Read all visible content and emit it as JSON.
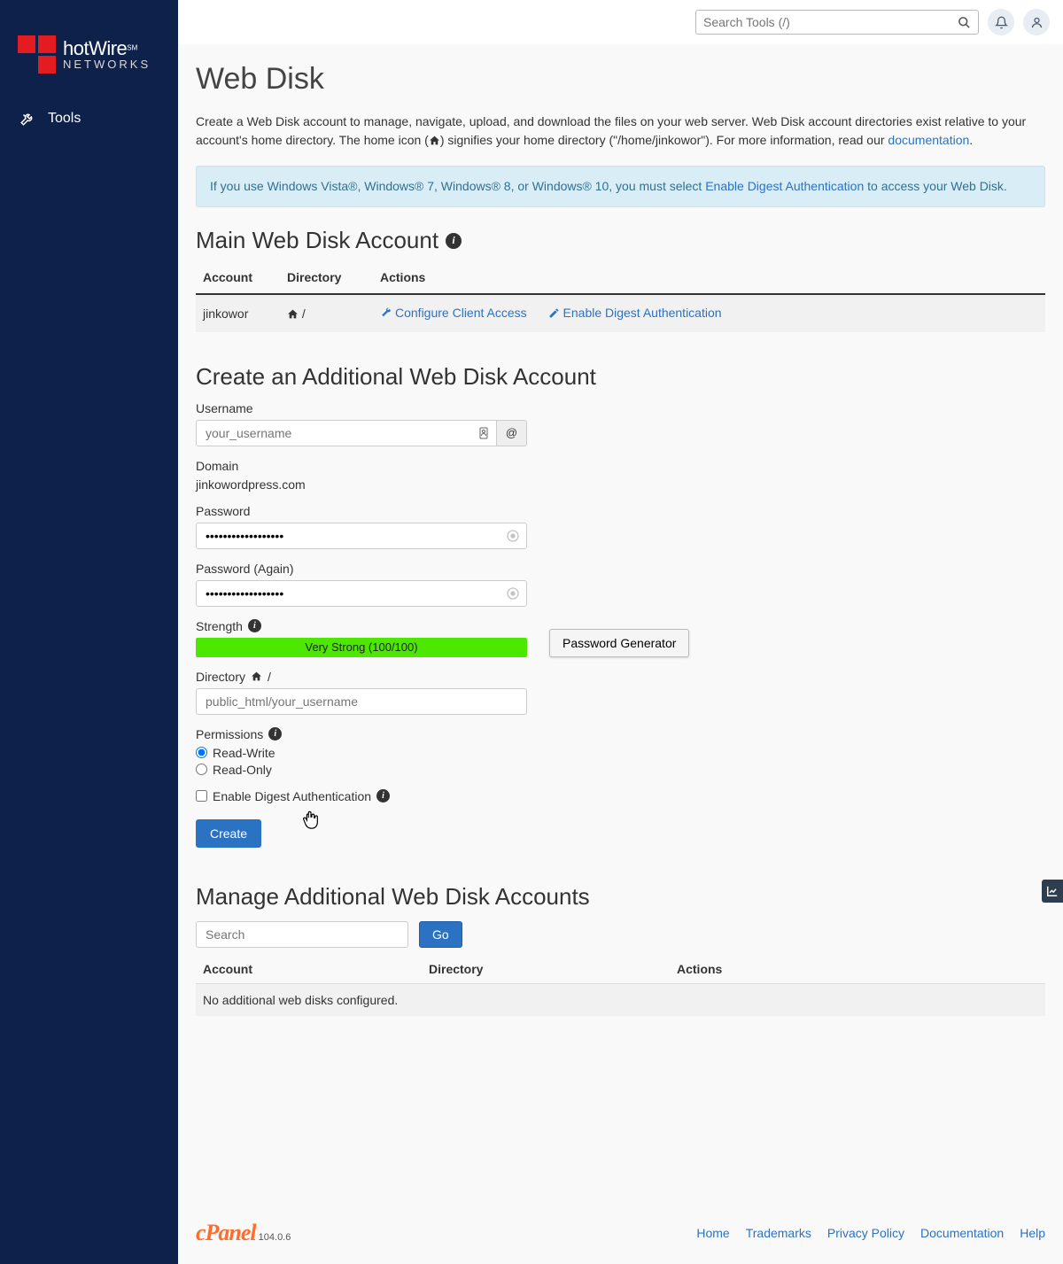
{
  "sidebar": {
    "brand_main": "hotWire",
    "brand_sm": "SM",
    "brand_sub": "NETWORKS",
    "tools_label": "Tools"
  },
  "topbar": {
    "search_placeholder": "Search Tools (/)"
  },
  "page": {
    "title": "Web Disk",
    "intro_1": "Create a Web Disk account to manage, navigate, upload, and download the files on your web server. Web Disk account directories exist relative to your account's home directory. The home icon (",
    "intro_2": ") signifies your home directory (\"/home/jinkowor\"). For more information, read our ",
    "doc_link": "documentation",
    "intro_3": ".",
    "alert_1": "If you use Windows Vista®, Windows® 7, Windows® 8, or Windows® 10, you must select ",
    "alert_link": "Enable Digest Authentication",
    "alert_2": " to access your Web Disk."
  },
  "main_account": {
    "heading": "Main Web Disk Account",
    "columns": {
      "account": "Account",
      "directory": "Directory",
      "actions": "Actions"
    },
    "row": {
      "account": "jinkowor",
      "directory": "/",
      "configure": "Configure Client Access",
      "enable_digest": "Enable Digest Authentication"
    }
  },
  "create": {
    "heading": "Create an Additional Web Disk Account",
    "username_label": "Username",
    "username_placeholder": "your_username",
    "at_symbol": "@",
    "domain_label": "Domain",
    "domain_value": "jinkowordpress.com",
    "password_label": "Password",
    "password_value": "••••••••••••••••••",
    "password_again_label": "Password (Again)",
    "strength_label": "Strength",
    "strength_text": "Very Strong (100/100)",
    "pw_gen_label": "Password Generator",
    "directory_label": "Directory",
    "directory_slash": "/",
    "directory_placeholder": "public_html/your_username",
    "permissions_label": "Permissions",
    "perm_rw": "Read-Write",
    "perm_ro": "Read-Only",
    "enable_digest_label": "Enable Digest Authentication",
    "create_btn": "Create"
  },
  "manage": {
    "heading": "Manage Additional Web Disk Accounts",
    "search_placeholder": "Search",
    "go_label": "Go",
    "columns": {
      "account": "Account",
      "directory": "Directory",
      "actions": "Actions"
    },
    "empty_text": "No additional web disks configured."
  },
  "footer": {
    "cpanel": "cPanel",
    "version": "104.0.6",
    "links": {
      "home": "Home",
      "trademarks": "Trademarks",
      "privacy": "Privacy Policy",
      "documentation": "Documentation",
      "help": "Help"
    }
  }
}
